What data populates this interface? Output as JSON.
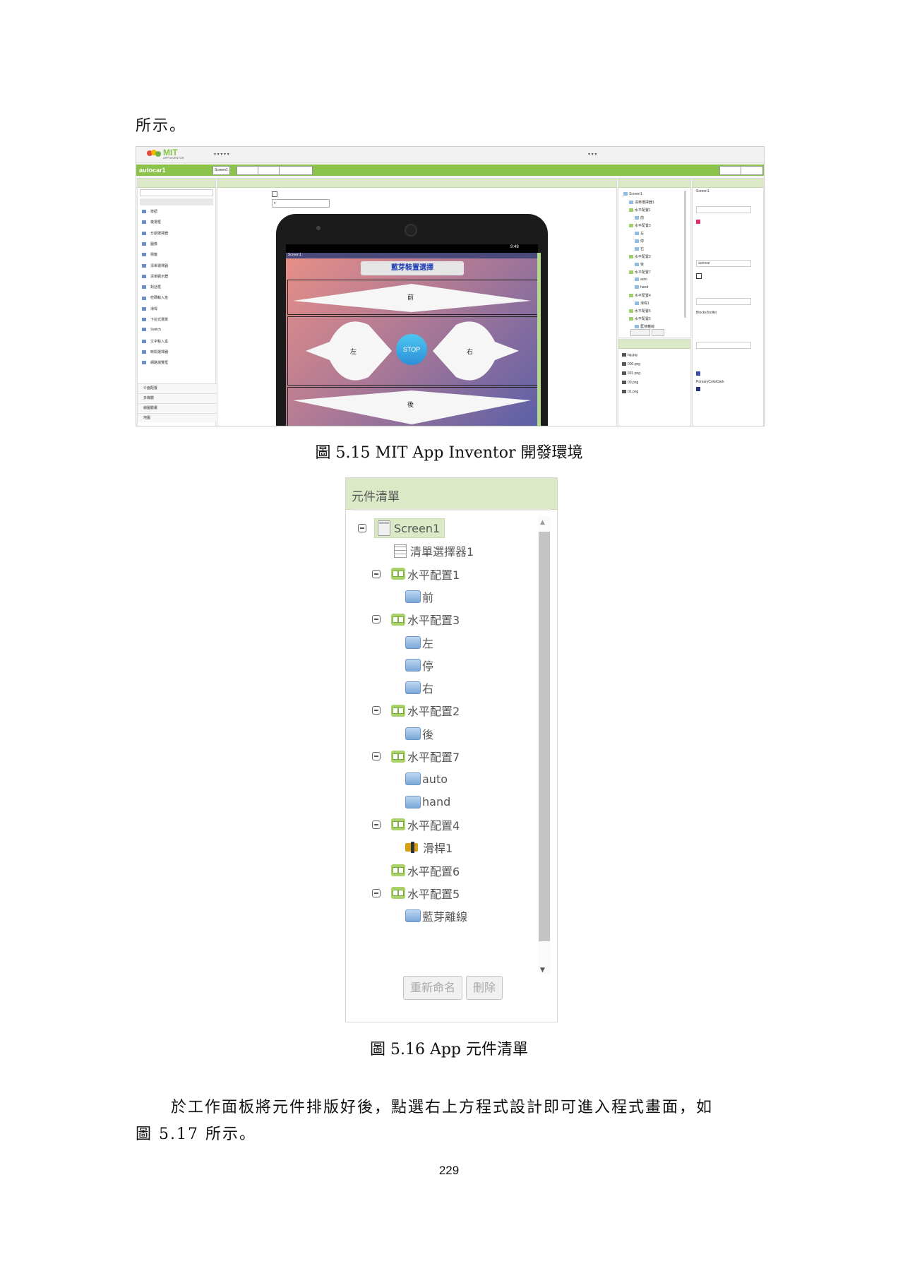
{
  "page": {
    "intro_line": "所示。",
    "fig1_caption": "圖 5.15 MIT App Inventor  開發環境",
    "fig2_caption": "圖 5.16 App  元件清單",
    "para_line1": "於工作面板將元件排版好後，點選右上方程式設計即可進入程式畫面，如",
    "para_line2": "圖 5.17 所示。",
    "page_number": "229"
  },
  "ide": {
    "logo": "MIT",
    "logo_sub": "APP INVENTOR",
    "project_name": "autocar1",
    "accent_color": "#8bc34a",
    "screen_title": "Screen1",
    "phone_title_button": "藍芽裝置選擇",
    "btn_forward": "前",
    "btn_left": "左",
    "btn_stop": "STOP",
    "btn_right": "右",
    "btn_back": "後",
    "time": "9:48",
    "palette_items": [
      "按鈕",
      "複選框",
      "日期選擇器",
      "圖像",
      "標籤",
      "清單選擇器",
      "清單顯示器",
      "對話框",
      "密碼輸入盒",
      "滑桿",
      "下拉式選單",
      "Switch",
      "文字輸入盒",
      "時間選擇器",
      "網路瀏覽框"
    ],
    "palette_cats": [
      "介面配置",
      "多媒體",
      "繪圖動畫",
      "地圖"
    ],
    "media": [
      "bg.jpg",
      "000.png",
      "001.png",
      "00.png",
      "01.png"
    ],
    "props": [
      "Screen1",
      "BlocksToolkit",
      "PrimaryColorDark",
      "autocar"
    ]
  },
  "tree": {
    "header": "元件清單",
    "nodes": [
      "Screen1",
      "清單選擇器1",
      "水平配置1",
      "前",
      "水平配置3",
      "左",
      "停",
      "右",
      "水平配置2",
      "後",
      "水平配置7",
      "auto",
      "hand",
      "水平配置4",
      "滑桿1",
      "水平配置6",
      "水平配置5",
      "藍芽離線"
    ],
    "rename_button": "重新命名",
    "delete_button": "刪除"
  }
}
